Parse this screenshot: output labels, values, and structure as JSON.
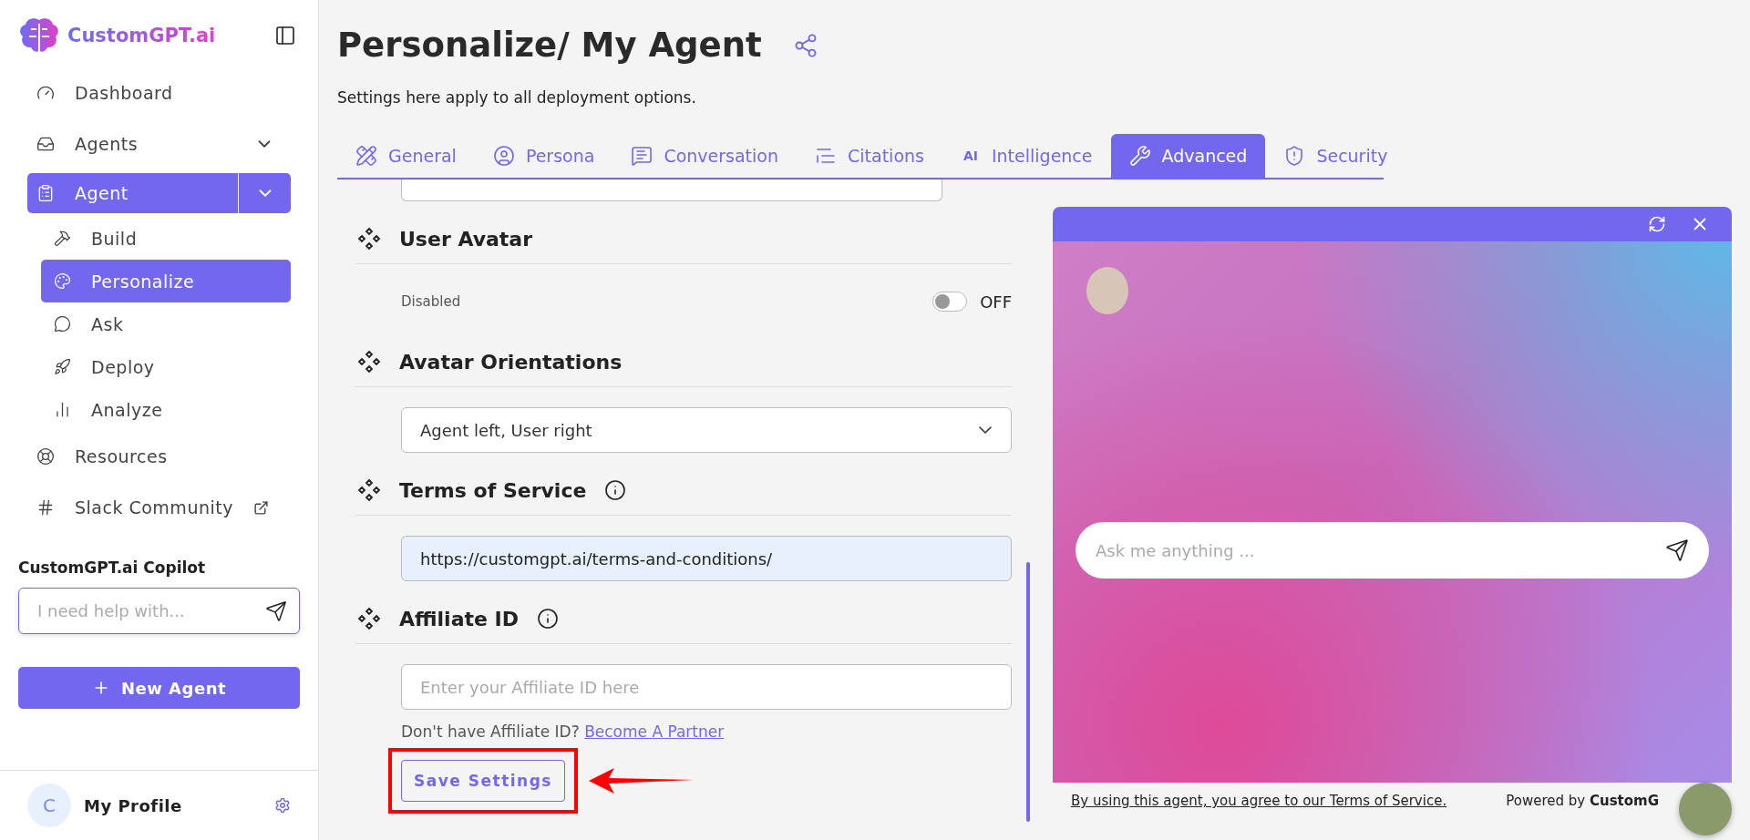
{
  "sidebar": {
    "logo": "CustomGPT.ai",
    "nav": [
      {
        "kind": "link",
        "label": "Dashboard",
        "selected": false
      },
      {
        "kind": "collapsible",
        "label": "Agents",
        "selected": false
      },
      {
        "kind": "group",
        "label": "Agent",
        "selected": true,
        "children": [
          {
            "label": "Build",
            "selected": false
          },
          {
            "label": "Personalize",
            "selected": true
          },
          {
            "label": "Ask",
            "selected": false
          },
          {
            "label": "Deploy",
            "selected": false
          },
          {
            "label": "Analyze",
            "selected": false
          }
        ]
      },
      {
        "kind": "link",
        "label": "Resources",
        "selected": false
      },
      {
        "kind": "external",
        "label": "Slack Community",
        "selected": false
      }
    ],
    "copilot": {
      "title": "CustomGPT.ai Copilot",
      "placeholder": "I need help with..."
    },
    "new_agent_button": "New Agent",
    "profile": {
      "initial": "C",
      "name": "My Profile"
    }
  },
  "page": {
    "title": "Personalize/ My Agent",
    "subtitle": "Settings here apply to all deployment options."
  },
  "tabs": [
    {
      "label": "General",
      "selected": false
    },
    {
      "label": "Persona",
      "selected": false
    },
    {
      "label": "Conversation",
      "selected": false
    },
    {
      "label": "Citations",
      "selected": false
    },
    {
      "label": "Intelligence",
      "glyph": "AI",
      "selected": false
    },
    {
      "label": "Advanced",
      "selected": true
    },
    {
      "label": "Security",
      "selected": false
    }
  ],
  "sections": [
    {
      "kind": "toggle",
      "title": "User Avatar",
      "info": false,
      "label": "Disabled",
      "on": false,
      "state_label": "OFF"
    },
    {
      "kind": "select",
      "title": "Avatar Orientations",
      "info": false,
      "value": "Agent left, User right"
    },
    {
      "kind": "input",
      "title": "Terms of Service",
      "info": true,
      "value": "https://customgpt.ai/terms-and-conditions/"
    },
    {
      "kind": "affiliate",
      "title": "Affiliate ID",
      "info": true,
      "placeholder": "Enter your Affiliate ID here",
      "note": "Don't have Affiliate ID?",
      "link": "Become A Partner"
    }
  ],
  "save_button": "Save Settings",
  "chat_preview": {
    "placeholder": "Ask me anything ...",
    "terms": "By using this agent, you agree to our Terms of Service.",
    "powered": "Powered by **CustomG**"
  }
}
